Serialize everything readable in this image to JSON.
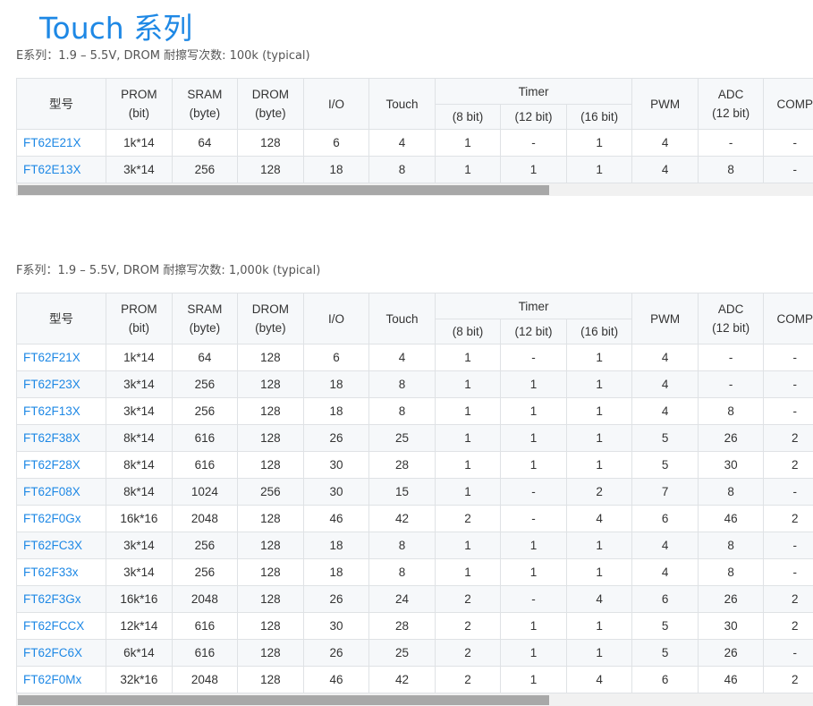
{
  "page": {
    "title": "Touch 系列"
  },
  "headers": {
    "model": "型号",
    "prom": "PROM",
    "prom_unit": "(bit)",
    "sram": "SRAM",
    "sram_unit": "(byte)",
    "drom": "DROM",
    "drom_unit": "(byte)",
    "io": "I/O",
    "touch": "Touch",
    "timer": "Timer",
    "timer_8": "(8 bit)",
    "timer_12": "(12 bit)",
    "timer_16": "(16 bit)",
    "pwm": "PWM",
    "adc": "ADC",
    "adc_unit": "(12 bit)",
    "comp": "COMP"
  },
  "series_e": {
    "description": "E系列：1.9 – 5.5V, DROM 耐擦写次数: 100k (typical)",
    "rows": [
      [
        "FT62E21X",
        "1k*14",
        "64",
        "128",
        "6",
        "4",
        "1",
        "-",
        "1",
        "4",
        "-",
        "-"
      ],
      [
        "FT62E13X",
        "3k*14",
        "256",
        "128",
        "18",
        "8",
        "1",
        "1",
        "1",
        "4",
        "8",
        "-"
      ]
    ]
  },
  "series_f": {
    "description": "F系列：1.9 – 5.5V, DROM 耐擦写次数: 1,000k (typical)",
    "rows": [
      [
        "FT62F21X",
        "1k*14",
        "64",
        "128",
        "6",
        "4",
        "1",
        "-",
        "1",
        "4",
        "-",
        "-"
      ],
      [
        "FT62F23X",
        "3k*14",
        "256",
        "128",
        "18",
        "8",
        "1",
        "1",
        "1",
        "4",
        "-",
        "-"
      ],
      [
        "FT62F13X",
        "3k*14",
        "256",
        "128",
        "18",
        "8",
        "1",
        "1",
        "1",
        "4",
        "8",
        "-"
      ],
      [
        "FT62F38X",
        "8k*14",
        "616",
        "128",
        "26",
        "25",
        "1",
        "1",
        "1",
        "5",
        "26",
        "2"
      ],
      [
        "FT62F28X",
        "8k*14",
        "616",
        "128",
        "30",
        "28",
        "1",
        "1",
        "1",
        "5",
        "30",
        "2"
      ],
      [
        "FT62F08X",
        "8k*14",
        "1024",
        "256",
        "30",
        "15",
        "1",
        "-",
        "2",
        "7",
        "8",
        "-"
      ],
      [
        "FT62F0Gx",
        "16k*16",
        "2048",
        "128",
        "46",
        "42",
        "2",
        "-",
        "4",
        "6",
        "46",
        "2"
      ],
      [
        "FT62FC3X",
        "3k*14",
        "256",
        "128",
        "18",
        "8",
        "1",
        "1",
        "1",
        "4",
        "8",
        "-"
      ],
      [
        "FT62F33x",
        "3k*14",
        "256",
        "128",
        "18",
        "8",
        "1",
        "1",
        "1",
        "4",
        "8",
        "-"
      ],
      [
        "FT62F3Gx",
        "16k*16",
        "2048",
        "128",
        "26",
        "24",
        "2",
        "-",
        "4",
        "6",
        "26",
        "2"
      ],
      [
        "FT62FCCX",
        "12k*14",
        "616",
        "128",
        "30",
        "28",
        "2",
        "1",
        "1",
        "5",
        "30",
        "2"
      ],
      [
        "FT62FC6X",
        "6k*14",
        "616",
        "128",
        "26",
        "25",
        "2",
        "1",
        "1",
        "5",
        "26",
        "-"
      ],
      [
        "FT62F0Mx",
        "32k*16",
        "2048",
        "128",
        "46",
        "42",
        "2",
        "1",
        "4",
        "6",
        "46",
        "2"
      ]
    ]
  },
  "colors": {
    "accent": "#1e88e5",
    "header_bg": "#f6f8fa",
    "border": "#dfe2e5",
    "scrollbar_thumb": "#a8a8a8",
    "scrollbar_track": "#f1f1f1"
  }
}
